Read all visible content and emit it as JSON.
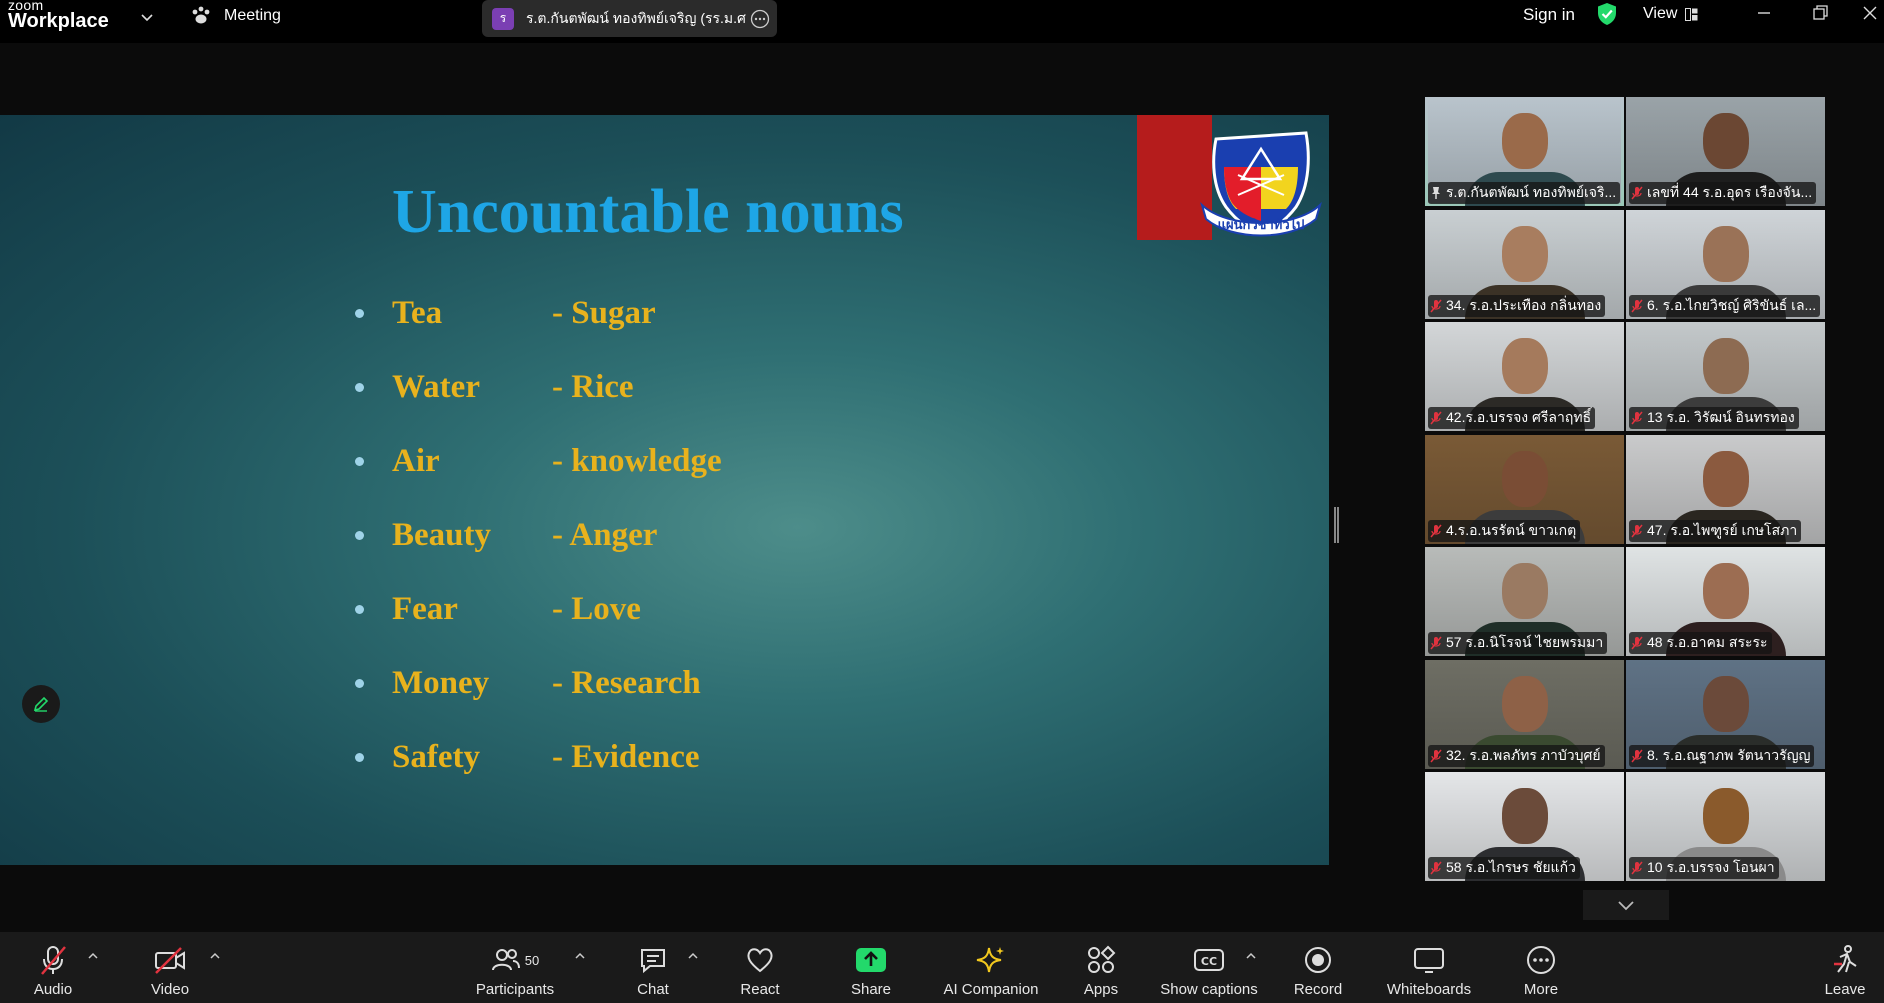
{
  "titlebar": {
    "brand_top": "zoom",
    "brand_bottom": "Workplace",
    "meeting_label": "Meeting",
    "speaker_initial": "ร",
    "speaker_name": "ร.ต.กันตพัฒน์ ทองทิพย์เจริญ (รร.ม.ศม",
    "sign_in": "Sign in",
    "view": "View"
  },
  "slide": {
    "title": "Uncountable nouns",
    "rows": [
      {
        "left": "Tea",
        "right": "- Sugar"
      },
      {
        "left": "Water",
        "right": "- Rice"
      },
      {
        "left": "Air",
        "right": "- knowledge"
      },
      {
        "left": "Beauty",
        "right": "- Anger"
      },
      {
        "left": "Fear",
        "right": "- Love"
      },
      {
        "left": "Money",
        "right": "- Research"
      },
      {
        "left": "Safety",
        "right": "- Evidence"
      }
    ],
    "emblem_text": "แผนกวิชาทั่วไป",
    "colors": {
      "title": "#1ea6e6",
      "body": "#e8b21d",
      "accent_bar": "#b51c1c"
    }
  },
  "gallery": {
    "participants": [
      {
        "name": "ร.ต.กันตพัฒน์ ทองทิพย์เจริ...",
        "pinned": true,
        "muted": false,
        "active": true
      },
      {
        "name": "เลขที่ 44 ร.อ.อุดร   เรืองจัน...",
        "muted": true
      },
      {
        "name": "34. ร.อ.ประเทือง  กลิ่นทอง",
        "muted": true
      },
      {
        "name": "6. ร.อ.ไกยวิชญ์ ศิริขันธ์ เล...",
        "muted": true
      },
      {
        "name": "42.ร.อ.บรรจง ศรีลาฤทธิ์",
        "muted": true
      },
      {
        "name": "13  ร.อ. วิรัฒน์  อินทรทอง",
        "muted": true
      },
      {
        "name": "4.ร.อ.นรรัตน์ ขาวเกตุ",
        "muted": true
      },
      {
        "name": "47. ร.อ.ไพฑูรย์ เกษโสภา",
        "muted": true
      },
      {
        "name": "57 ร.อ.นิโรจน์  ไชยพรมมา",
        "muted": true
      },
      {
        "name": "48 ร.อ.อาคม สระระ",
        "muted": true
      },
      {
        "name": "32. ร.อ.พลภัทร ภาบัวบุศย์",
        "muted": true
      },
      {
        "name": "8. ร.อ.ณฐาภพ รัตนาวรัญญ",
        "muted": true
      },
      {
        "name": "58 ร.อ.ไกรษร  ชัยแก้ว",
        "muted": true
      },
      {
        "name": "10 ร.อ.บรรจง โอนผา",
        "muted": true
      }
    ]
  },
  "toolbar": {
    "audio": "Audio",
    "video": "Video",
    "participants": "Participants",
    "participants_count": "50",
    "chat": "Chat",
    "react": "React",
    "share": "Share",
    "ai_companion": "AI Companion",
    "apps": "Apps",
    "show_captions": "Show captions",
    "record": "Record",
    "whiteboards": "Whiteboards",
    "more": "More",
    "leave": "Leave",
    "colors": {
      "share": "#23d96b",
      "muted": "#e0333f",
      "leave": "#e0333f"
    }
  }
}
